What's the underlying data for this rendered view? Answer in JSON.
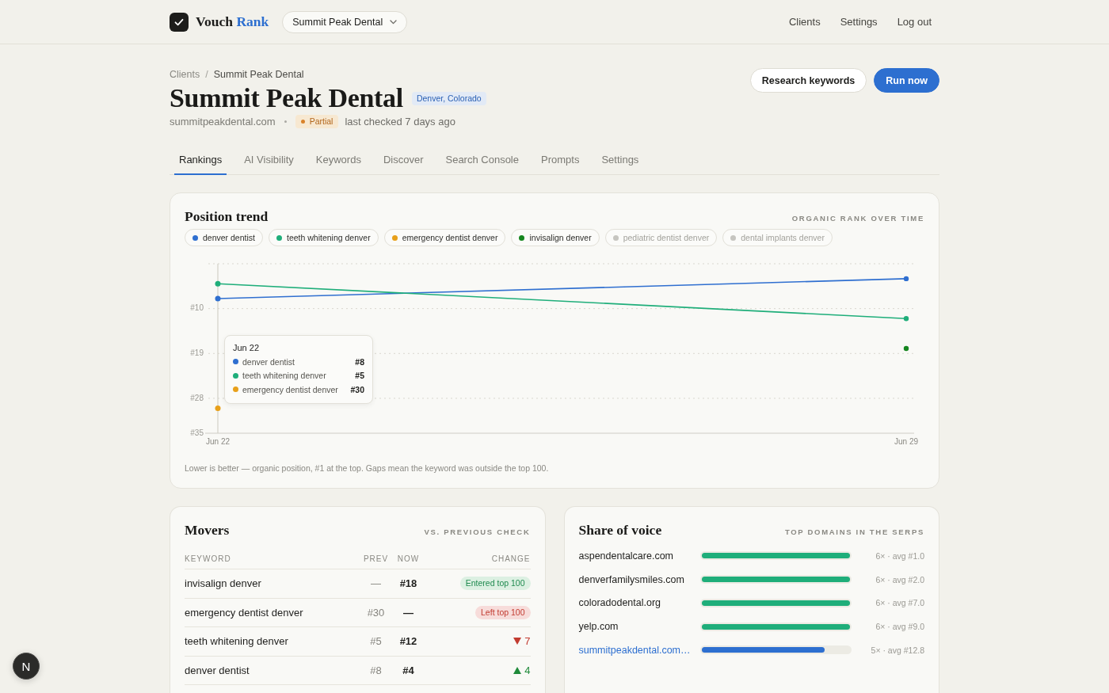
{
  "header": {
    "brand": {
      "name": "Vouch",
      "accent": "Rank"
    },
    "client_switcher": {
      "value": "Summit Peak Dental"
    },
    "nav": [
      "Clients",
      "Settings",
      "Log out"
    ]
  },
  "client": {
    "breadcrumb": {
      "items": [
        "Clients",
        "Summit Peak Dental"
      ],
      "separator": "/"
    },
    "title": "Summit Peak Dental",
    "location": "Denver, Colorado",
    "domain": "summitpeakdental.com",
    "status": {
      "kind": "partial",
      "label": "Partial"
    },
    "last_checked": "last checked 7 days ago",
    "actions": [
      {
        "kind": "secondary",
        "label": "Research keywords"
      },
      {
        "kind": "primary",
        "label": "Run now"
      }
    ]
  },
  "tabs": [
    {
      "label": "Rankings",
      "selected": true
    },
    {
      "label": "AI Visibility",
      "selected": false
    },
    {
      "label": "Keywords",
      "selected": false
    },
    {
      "label": "Discover",
      "selected": false
    },
    {
      "label": "Search Console",
      "selected": false
    },
    {
      "label": "Prompts",
      "selected": false
    },
    {
      "label": "Settings",
      "selected": false
    }
  ],
  "position_trend": {
    "title": "Position trend",
    "subtitle": "ORGANIC RANK OVER TIME",
    "legend_states": [
      {
        "muted": false
      },
      {
        "muted": false
      },
      {
        "muted": false
      },
      {
        "muted": false
      },
      {
        "muted": true
      },
      {
        "muted": true
      }
    ],
    "chart_data": {
      "type": "line",
      "legend": "top",
      "x": [
        "Jun 22",
        "Jun 29"
      ],
      "ylim": [
        35,
        1
      ],
      "yticks": [
        {
          "value": 10,
          "label": "#10"
        },
        {
          "value": 19,
          "label": "#19"
        },
        {
          "value": 28,
          "label": "#28"
        },
        {
          "value": 35,
          "label": "#35"
        }
      ],
      "ref_lines": [
        {
          "axis": "y",
          "value": 1
        },
        {
          "axis": "y",
          "value": 10
        },
        {
          "axis": "y",
          "value": 19
        },
        {
          "axis": "y",
          "value": 28
        },
        {
          "axis": "x",
          "value": "Jun 22"
        }
      ],
      "series": [
        {
          "name": "denver dentist",
          "color": "#2f6fd0",
          "values": [
            8,
            4
          ],
          "marker": "circle"
        },
        {
          "name": "teeth whitening denver",
          "color": "#1fae7a",
          "values": [
            5,
            12
          ],
          "marker": "circle"
        },
        {
          "name": "emergency dentist denver",
          "color": "#e8a01a",
          "values": [
            30,
            null
          ],
          "marker": "circle"
        },
        {
          "name": "invisalign denver",
          "color": "#15861f",
          "values": [
            null,
            18
          ],
          "marker": "circle"
        },
        {
          "name": "pediatric dentist denver",
          "color": "#c6c5c0",
          "values": [
            null,
            null
          ]
        },
        {
          "name": "dental implants denver",
          "color": "#c6c5c0",
          "values": [
            null,
            null
          ]
        }
      ]
    },
    "tooltip": {
      "title": "Jun 22",
      "rows": [
        {
          "label": "denver dentist",
          "value": "#8",
          "color": "#2f6fd0"
        },
        {
          "label": "teeth whitening denver",
          "value": "#5",
          "color": "#1fae7a"
        },
        {
          "label": "emergency dentist denver",
          "value": "#30",
          "color": "#e8a01a"
        }
      ]
    },
    "note": "Lower is better — organic position, #1 at the top. Gaps mean the keyword was outside the top 100."
  },
  "movers": {
    "title": "Movers",
    "subtitle": "VS. PREVIOUS CHECK",
    "columns": [
      "KEYWORD",
      "PREV",
      "NOW",
      "CHANGE"
    ],
    "rows": [
      {
        "keyword": "invisalign denver",
        "prev": "—",
        "now": "#18",
        "change": {
          "kind": "entered",
          "text": "Entered top 100"
        }
      },
      {
        "keyword": "emergency dentist denver",
        "prev": "#30",
        "now": "—",
        "change": {
          "kind": "left",
          "text": "Left top 100"
        }
      },
      {
        "keyword": "teeth whitening denver",
        "prev": "#5",
        "now": "#12",
        "change": {
          "kind": "down",
          "text": "7"
        }
      },
      {
        "keyword": "denver dentist",
        "prev": "#8",
        "now": "#4",
        "change": {
          "kind": "up",
          "text": "4"
        }
      }
    ]
  },
  "share_of_voice": {
    "title": "Share of voice",
    "subtitle": "TOP DOMAINS IN THE SERPS",
    "rows": [
      {
        "domain": "aspendentalcare.com",
        "level": 1,
        "reading": "6× · avg #1.0",
        "own": false
      },
      {
        "domain": "denverfamilysmiles.com",
        "level": 1,
        "reading": "6× · avg #2.0",
        "own": false
      },
      {
        "domain": "coloradodental.org",
        "level": 1,
        "reading": "6× · avg #7.0",
        "own": false
      },
      {
        "domain": "yelp.com",
        "level": 1,
        "reading": "6× · avg #9.0",
        "own": false
      },
      {
        "domain": "summitpeakdental.com…",
        "level": 0.83,
        "reading": "5× · avg #12.8",
        "own": true
      }
    ]
  },
  "dev_badge": {
    "label": "N"
  }
}
